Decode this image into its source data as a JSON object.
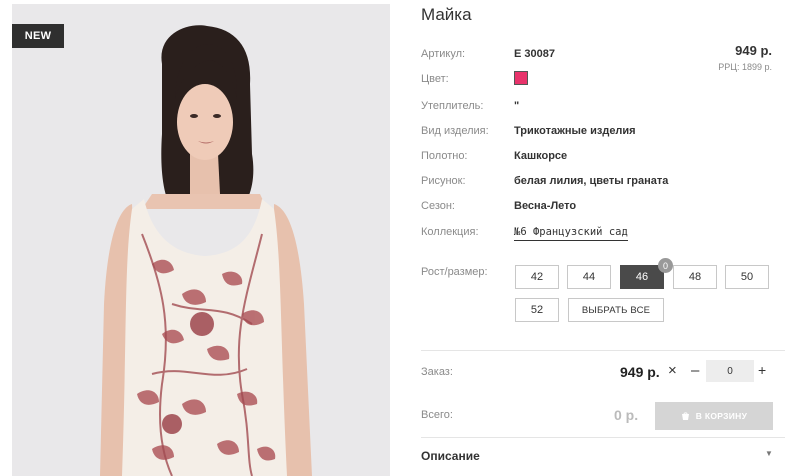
{
  "product": {
    "badge": "NEW",
    "title": "Майка",
    "price": "949 р.",
    "rrp": "РРЦ: 1899 р."
  },
  "specs": [
    {
      "label": "Артикул:",
      "value": "Е 30087"
    },
    {
      "label": "Цвет:",
      "value": ""
    },
    {
      "label": "Утеплитель:",
      "value": "\""
    },
    {
      "label": "Вид изделия:",
      "value": "Трикотажные изделия"
    },
    {
      "label": "Полотно:",
      "value": "Кашкорсе"
    },
    {
      "label": "Рисунок:",
      "value": "белая лилия, цветы граната"
    },
    {
      "label": "Сезон:",
      "value": "Весна-Лето"
    },
    {
      "label": "Коллекция:",
      "value": "№6 Французский сад"
    }
  ],
  "color_swatch": "#e8336b",
  "sizes": {
    "label": "Рост/размер:",
    "options": [
      "42",
      "44",
      "46",
      "48",
      "50",
      "52"
    ],
    "selected": "46",
    "selected_count": "0",
    "select_all": "ВЫБРАТЬ ВСЕ"
  },
  "order": {
    "label": "Заказ:",
    "price": "949 р.",
    "times": "×",
    "minus": "–",
    "qty": "0",
    "plus": "+"
  },
  "total": {
    "label": "Всего:",
    "value": "0 р.",
    "cart_button": "В КОРЗИНУ"
  },
  "description": {
    "label": "Описание"
  }
}
